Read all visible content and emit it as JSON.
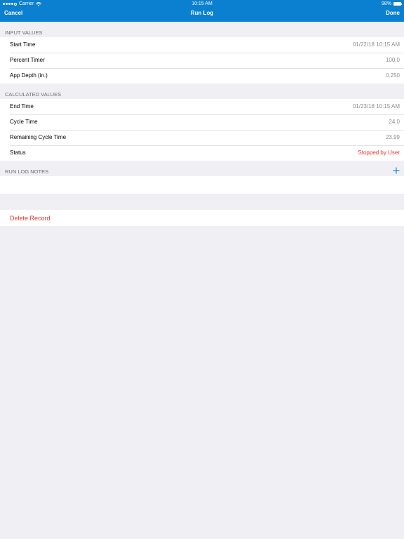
{
  "status_bar": {
    "carrier": "Carrier",
    "time": "10:15 AM",
    "battery": "98%",
    "battery_level": 0.98
  },
  "nav": {
    "cancel_label": "Cancel",
    "title": "Run Log",
    "done_label": "Done"
  },
  "input_values": {
    "header": "INPUT VALUES",
    "rows": [
      {
        "label": "Start Time",
        "value": "01/22/18 10:15 AM"
      },
      {
        "label": "Percent Timer",
        "value": "100.0"
      },
      {
        "label": "App Depth (in.)",
        "value": "0.250"
      }
    ]
  },
  "calculated_values": {
    "header": "CALCULATED VALUES",
    "rows": [
      {
        "label": "End Time",
        "value": "01/23/18 10:15 AM"
      },
      {
        "label": "Cycle Time",
        "value": "24.0"
      },
      {
        "label": "Remaining Cycle Time",
        "value": "23.99"
      },
      {
        "label": "Status",
        "value": "Stopped by User"
      }
    ]
  },
  "notes": {
    "header": "RUN LOG NOTES",
    "add_icon": "plus-icon"
  },
  "delete": {
    "label": "Delete Record"
  },
  "colors": {
    "nav_bar": "#0b7fd0",
    "background": "#efeff4",
    "destructive": "#e8322b",
    "accent": "#1a8ae0"
  }
}
